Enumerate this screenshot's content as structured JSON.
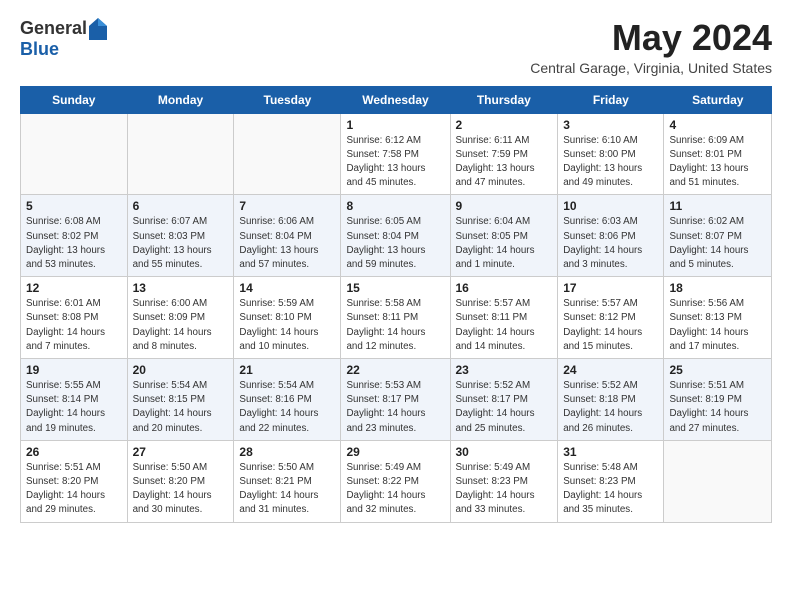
{
  "logo": {
    "general": "General",
    "blue": "Blue"
  },
  "header": {
    "title": "May 2024",
    "subtitle": "Central Garage, Virginia, United States"
  },
  "weekdays": [
    "Sunday",
    "Monday",
    "Tuesday",
    "Wednesday",
    "Thursday",
    "Friday",
    "Saturday"
  ],
  "weeks": [
    [
      {
        "day": "",
        "info": ""
      },
      {
        "day": "",
        "info": ""
      },
      {
        "day": "",
        "info": ""
      },
      {
        "day": "1",
        "info": "Sunrise: 6:12 AM\nSunset: 7:58 PM\nDaylight: 13 hours\nand 45 minutes."
      },
      {
        "day": "2",
        "info": "Sunrise: 6:11 AM\nSunset: 7:59 PM\nDaylight: 13 hours\nand 47 minutes."
      },
      {
        "day": "3",
        "info": "Sunrise: 6:10 AM\nSunset: 8:00 PM\nDaylight: 13 hours\nand 49 minutes."
      },
      {
        "day": "4",
        "info": "Sunrise: 6:09 AM\nSunset: 8:01 PM\nDaylight: 13 hours\nand 51 minutes."
      }
    ],
    [
      {
        "day": "5",
        "info": "Sunrise: 6:08 AM\nSunset: 8:02 PM\nDaylight: 13 hours\nand 53 minutes."
      },
      {
        "day": "6",
        "info": "Sunrise: 6:07 AM\nSunset: 8:03 PM\nDaylight: 13 hours\nand 55 minutes."
      },
      {
        "day": "7",
        "info": "Sunrise: 6:06 AM\nSunset: 8:04 PM\nDaylight: 13 hours\nand 57 minutes."
      },
      {
        "day": "8",
        "info": "Sunrise: 6:05 AM\nSunset: 8:04 PM\nDaylight: 13 hours\nand 59 minutes."
      },
      {
        "day": "9",
        "info": "Sunrise: 6:04 AM\nSunset: 8:05 PM\nDaylight: 14 hours\nand 1 minute."
      },
      {
        "day": "10",
        "info": "Sunrise: 6:03 AM\nSunset: 8:06 PM\nDaylight: 14 hours\nand 3 minutes."
      },
      {
        "day": "11",
        "info": "Sunrise: 6:02 AM\nSunset: 8:07 PM\nDaylight: 14 hours\nand 5 minutes."
      }
    ],
    [
      {
        "day": "12",
        "info": "Sunrise: 6:01 AM\nSunset: 8:08 PM\nDaylight: 14 hours\nand 7 minutes."
      },
      {
        "day": "13",
        "info": "Sunrise: 6:00 AM\nSunset: 8:09 PM\nDaylight: 14 hours\nand 8 minutes."
      },
      {
        "day": "14",
        "info": "Sunrise: 5:59 AM\nSunset: 8:10 PM\nDaylight: 14 hours\nand 10 minutes."
      },
      {
        "day": "15",
        "info": "Sunrise: 5:58 AM\nSunset: 8:11 PM\nDaylight: 14 hours\nand 12 minutes."
      },
      {
        "day": "16",
        "info": "Sunrise: 5:57 AM\nSunset: 8:11 PM\nDaylight: 14 hours\nand 14 minutes."
      },
      {
        "day": "17",
        "info": "Sunrise: 5:57 AM\nSunset: 8:12 PM\nDaylight: 14 hours\nand 15 minutes."
      },
      {
        "day": "18",
        "info": "Sunrise: 5:56 AM\nSunset: 8:13 PM\nDaylight: 14 hours\nand 17 minutes."
      }
    ],
    [
      {
        "day": "19",
        "info": "Sunrise: 5:55 AM\nSunset: 8:14 PM\nDaylight: 14 hours\nand 19 minutes."
      },
      {
        "day": "20",
        "info": "Sunrise: 5:54 AM\nSunset: 8:15 PM\nDaylight: 14 hours\nand 20 minutes."
      },
      {
        "day": "21",
        "info": "Sunrise: 5:54 AM\nSunset: 8:16 PM\nDaylight: 14 hours\nand 22 minutes."
      },
      {
        "day": "22",
        "info": "Sunrise: 5:53 AM\nSunset: 8:17 PM\nDaylight: 14 hours\nand 23 minutes."
      },
      {
        "day": "23",
        "info": "Sunrise: 5:52 AM\nSunset: 8:17 PM\nDaylight: 14 hours\nand 25 minutes."
      },
      {
        "day": "24",
        "info": "Sunrise: 5:52 AM\nSunset: 8:18 PM\nDaylight: 14 hours\nand 26 minutes."
      },
      {
        "day": "25",
        "info": "Sunrise: 5:51 AM\nSunset: 8:19 PM\nDaylight: 14 hours\nand 27 minutes."
      }
    ],
    [
      {
        "day": "26",
        "info": "Sunrise: 5:51 AM\nSunset: 8:20 PM\nDaylight: 14 hours\nand 29 minutes."
      },
      {
        "day": "27",
        "info": "Sunrise: 5:50 AM\nSunset: 8:20 PM\nDaylight: 14 hours\nand 30 minutes."
      },
      {
        "day": "28",
        "info": "Sunrise: 5:50 AM\nSunset: 8:21 PM\nDaylight: 14 hours\nand 31 minutes."
      },
      {
        "day": "29",
        "info": "Sunrise: 5:49 AM\nSunset: 8:22 PM\nDaylight: 14 hours\nand 32 minutes."
      },
      {
        "day": "30",
        "info": "Sunrise: 5:49 AM\nSunset: 8:23 PM\nDaylight: 14 hours\nand 33 minutes."
      },
      {
        "day": "31",
        "info": "Sunrise: 5:48 AM\nSunset: 8:23 PM\nDaylight: 14 hours\nand 35 minutes."
      },
      {
        "day": "",
        "info": ""
      }
    ]
  ]
}
